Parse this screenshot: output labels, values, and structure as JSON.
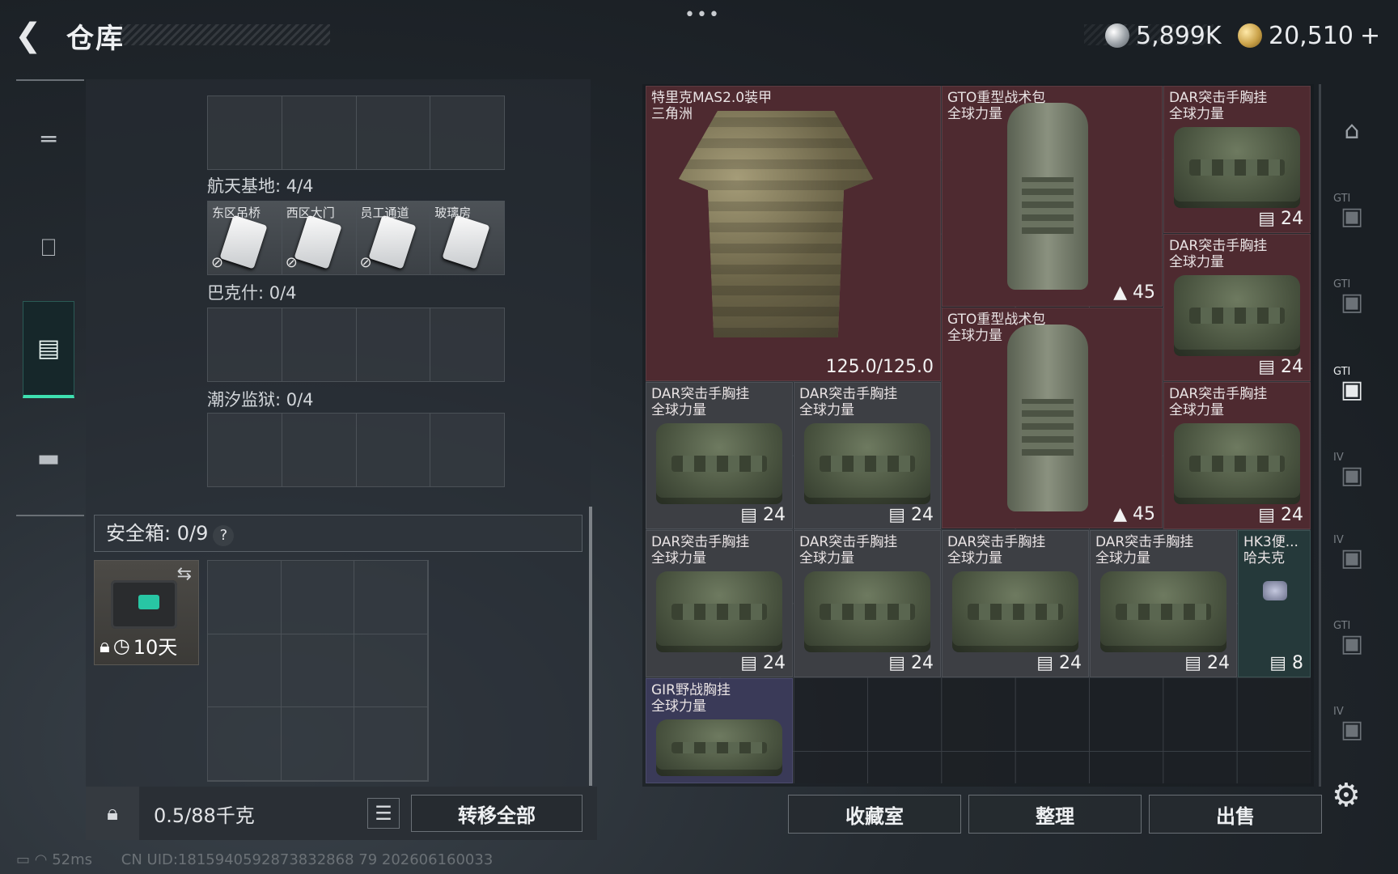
{
  "header": {
    "title": "仓库",
    "more": "•••"
  },
  "currency": {
    "silver": "5,899K",
    "gold": "20,510",
    "add": "+"
  },
  "left_nav": {
    "items": [
      "weapon-icon",
      "backpack-icon",
      "chest-rig-icon",
      "case-icon"
    ],
    "active": 2
  },
  "keys": {
    "section_top_label": "",
    "aerospace": {
      "label": "航天基地: 4/4",
      "cards": [
        "东区吊桥",
        "西区大门",
        "员工通道",
        "玻璃房"
      ]
    },
    "bakesh": {
      "label": "巴克什: 0/4"
    },
    "tide_prison": {
      "label": "潮汐监狱: 0/4"
    }
  },
  "safe": {
    "label": "安全箱: 0/9",
    "help": "?",
    "timer": "10天"
  },
  "weight": {
    "value": "0.5/88千克",
    "transfer_all": "转移全部"
  },
  "status_bar": {
    "ping": "52ms",
    "uid": "CN UID:1815940592873832868 79 202606160033"
  },
  "items": [
    {
      "id": "armor",
      "name": "特里克MAS2.0装甲",
      "sub": "三角洲",
      "count": "125.0/125.0"
    },
    {
      "id": "gto1",
      "name": "GTO重型战术包",
      "sub": "全球力量",
      "count": "45"
    },
    {
      "id": "dar1",
      "name": "DAR突击手胸挂",
      "sub": "全球力量",
      "count": "24"
    },
    {
      "id": "dar2",
      "name": "DAR突击手胸挂",
      "sub": "全球力量",
      "count": "24"
    },
    {
      "id": "gto2",
      "name": "GTO重型战术包",
      "sub": "全球力量",
      "count": "45"
    },
    {
      "id": "dar3",
      "name": "DAR突击手胸挂",
      "sub": "全球力量",
      "count": "24"
    },
    {
      "id": "dar4",
      "name": "DAR突击手胸挂",
      "sub": "全球力量",
      "count": "24"
    },
    {
      "id": "dar5",
      "name": "DAR突击手胸挂",
      "sub": "全球力量",
      "count": "24"
    },
    {
      "id": "dar6",
      "name": "DAR突击手胸挂",
      "sub": "全球力量",
      "count": "24"
    },
    {
      "id": "dar7",
      "name": "DAR突击手胸挂",
      "sub": "全球力量",
      "count": "24"
    },
    {
      "id": "dar8",
      "name": "DAR突击手胸挂",
      "sub": "全球力量",
      "count": "24"
    },
    {
      "id": "dar9",
      "name": "DAR突击手胸挂",
      "sub": "全球力量",
      "count": "24"
    },
    {
      "id": "hk3",
      "name": "HK3便...",
      "sub": "哈夫克",
      "count": "8"
    },
    {
      "id": "gir",
      "name": "GIR野战胸挂",
      "sub": "全球力量",
      "count": ""
    }
  ],
  "bottom_buttons": {
    "collection": "收藏室",
    "organize": "整理",
    "sell": "出售"
  },
  "right_nav": {
    "items": [
      "GTI",
      "GTI",
      "GTI",
      "IV",
      "IV",
      "GTI",
      "IV"
    ],
    "active": 2
  },
  "colors": {
    "accent": "#3ee0b0",
    "item_red": "#4e2a30"
  }
}
